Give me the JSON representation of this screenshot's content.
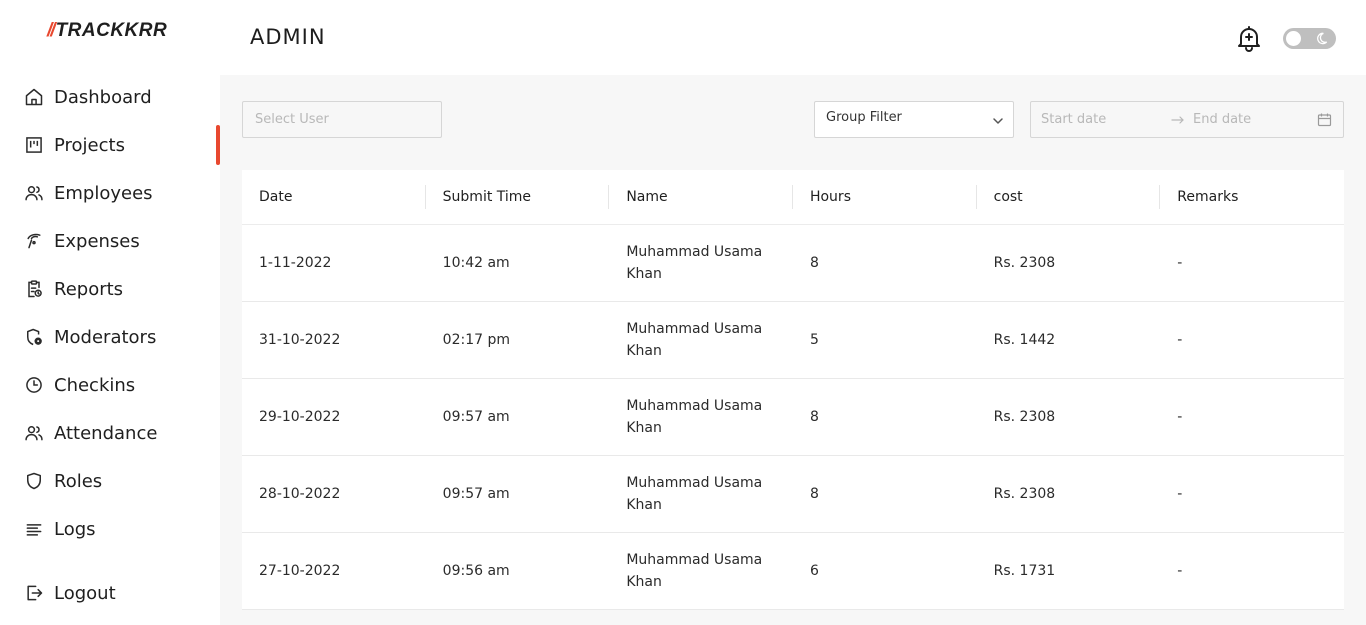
{
  "app": {
    "logo_slashes": "//",
    "logo_text": "TRACKKRR"
  },
  "sidebar": {
    "items": [
      {
        "label": "Dashboard",
        "icon": "home-icon"
      },
      {
        "label": "Projects",
        "icon": "kanban-icon",
        "active": true
      },
      {
        "label": "Employees",
        "icon": "users-icon"
      },
      {
        "label": "Expenses",
        "icon": "money-icon"
      },
      {
        "label": "Reports",
        "icon": "clipboard-icon"
      },
      {
        "label": "Moderators",
        "icon": "shield-gear-icon"
      },
      {
        "label": "Checkins",
        "icon": "clock-icon"
      },
      {
        "label": "Attendance",
        "icon": "users-icon"
      },
      {
        "label": "Roles",
        "icon": "shield-icon"
      },
      {
        "label": "Logs",
        "icon": "lines-icon"
      }
    ],
    "logout_label": "Logout"
  },
  "header": {
    "title": "ADMIN"
  },
  "filters": {
    "select_user_placeholder": "Select User",
    "group_filter_label": "Group Filter",
    "start_date_placeholder": "Start date",
    "end_date_placeholder": "End date"
  },
  "table": {
    "columns": [
      "Date",
      "Submit Time",
      "Name",
      "Hours",
      "cost",
      "Remarks"
    ],
    "rows": [
      {
        "date": "1-11-2022",
        "time": "10:42 am",
        "name": "Muhammad Usama Khan",
        "hours": "8",
        "cost": "Rs. 2308",
        "remarks": "-"
      },
      {
        "date": "31-10-2022",
        "time": "02:17 pm",
        "name": "Muhammad Usama Khan",
        "hours": "5",
        "cost": "Rs. 1442",
        "remarks": "-"
      },
      {
        "date": "29-10-2022",
        "time": "09:57 am",
        "name": "Muhammad Usama Khan",
        "hours": "8",
        "cost": "Rs. 2308",
        "remarks": "-"
      },
      {
        "date": "28-10-2022",
        "time": "09:57 am",
        "name": "Muhammad Usama Khan",
        "hours": "8",
        "cost": "Rs. 2308",
        "remarks": "-"
      },
      {
        "date": "27-10-2022",
        "time": "09:56 am",
        "name": "Muhammad Usama Khan",
        "hours": "6",
        "cost": "Rs. 1731",
        "remarks": "-"
      }
    ]
  },
  "colors": {
    "accent": "#e8482f",
    "background": "#f7f7f7",
    "toggle": "#bfbfbf"
  }
}
